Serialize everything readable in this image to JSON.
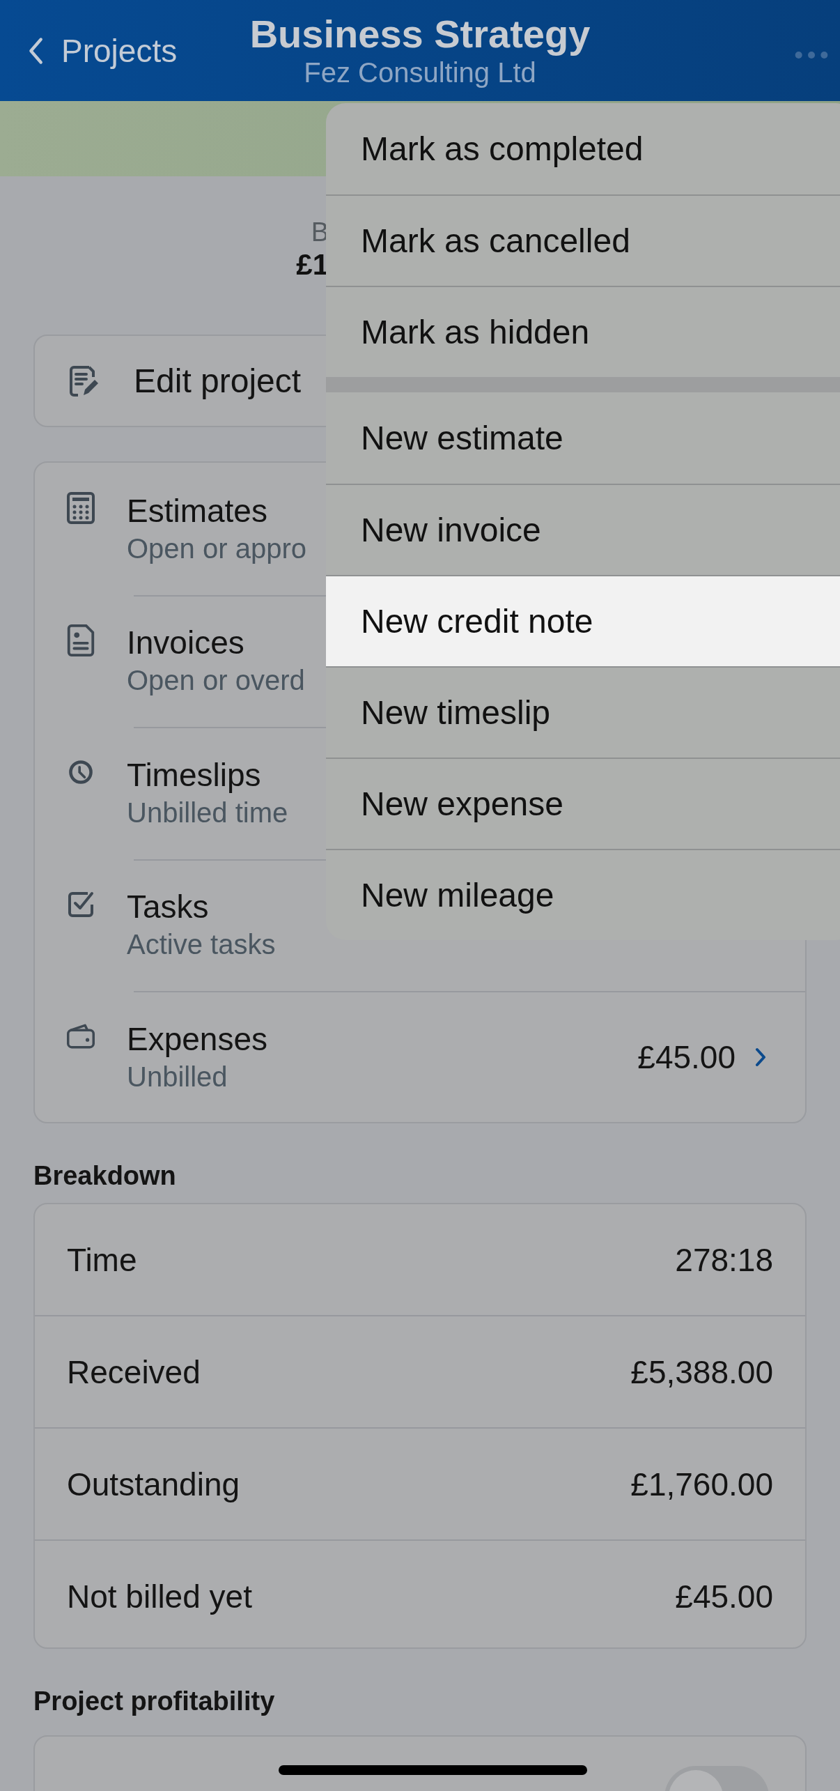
{
  "nav_bar": {
    "back_label": "Projects",
    "title": "Business Strategy",
    "subtitle": "Fez Consulting Ltd"
  },
  "summary": {
    "label": "B",
    "amount": "£1"
  },
  "edit_button": {
    "label": "Edit project"
  },
  "sections": [
    {
      "kind": "estimates",
      "title": "Estimates",
      "subtitle": "Open or appro"
    },
    {
      "kind": "invoices",
      "title": "Invoices",
      "subtitle": "Open or overd"
    },
    {
      "kind": "timeslips",
      "title": "Timeslips",
      "subtitle": "Unbilled time"
    },
    {
      "kind": "tasks",
      "title": "Tasks",
      "subtitle": "Active tasks"
    },
    {
      "kind": "expenses",
      "title": "Expenses",
      "subtitle": "Unbilled",
      "value": "£45.00"
    }
  ],
  "breakdown": {
    "heading": "Breakdown",
    "rows": [
      {
        "label": "Time",
        "value": "278:18"
      },
      {
        "label": "Received",
        "value": "£5,388.00"
      },
      {
        "label": "Outstanding",
        "value": "£1,760.00"
      },
      {
        "label": "Not billed yet",
        "value": "£45.00"
      }
    ]
  },
  "profitability": {
    "heading": "Project profitability",
    "toggle": {
      "on": false
    }
  },
  "menu": {
    "groups": [
      {
        "items": [
          {
            "label": "Mark as completed",
            "selected": false
          },
          {
            "label": "Mark as cancelled",
            "selected": false
          },
          {
            "label": "Mark as hidden",
            "selected": false
          }
        ]
      },
      {
        "items": [
          {
            "label": "New estimate",
            "selected": false
          },
          {
            "label": "New invoice",
            "selected": false
          },
          {
            "label": "New credit note",
            "selected": true
          },
          {
            "label": "New timeslip",
            "selected": false
          },
          {
            "label": "New expense",
            "selected": false
          },
          {
            "label": "New mileage",
            "selected": false
          }
        ]
      }
    ]
  }
}
